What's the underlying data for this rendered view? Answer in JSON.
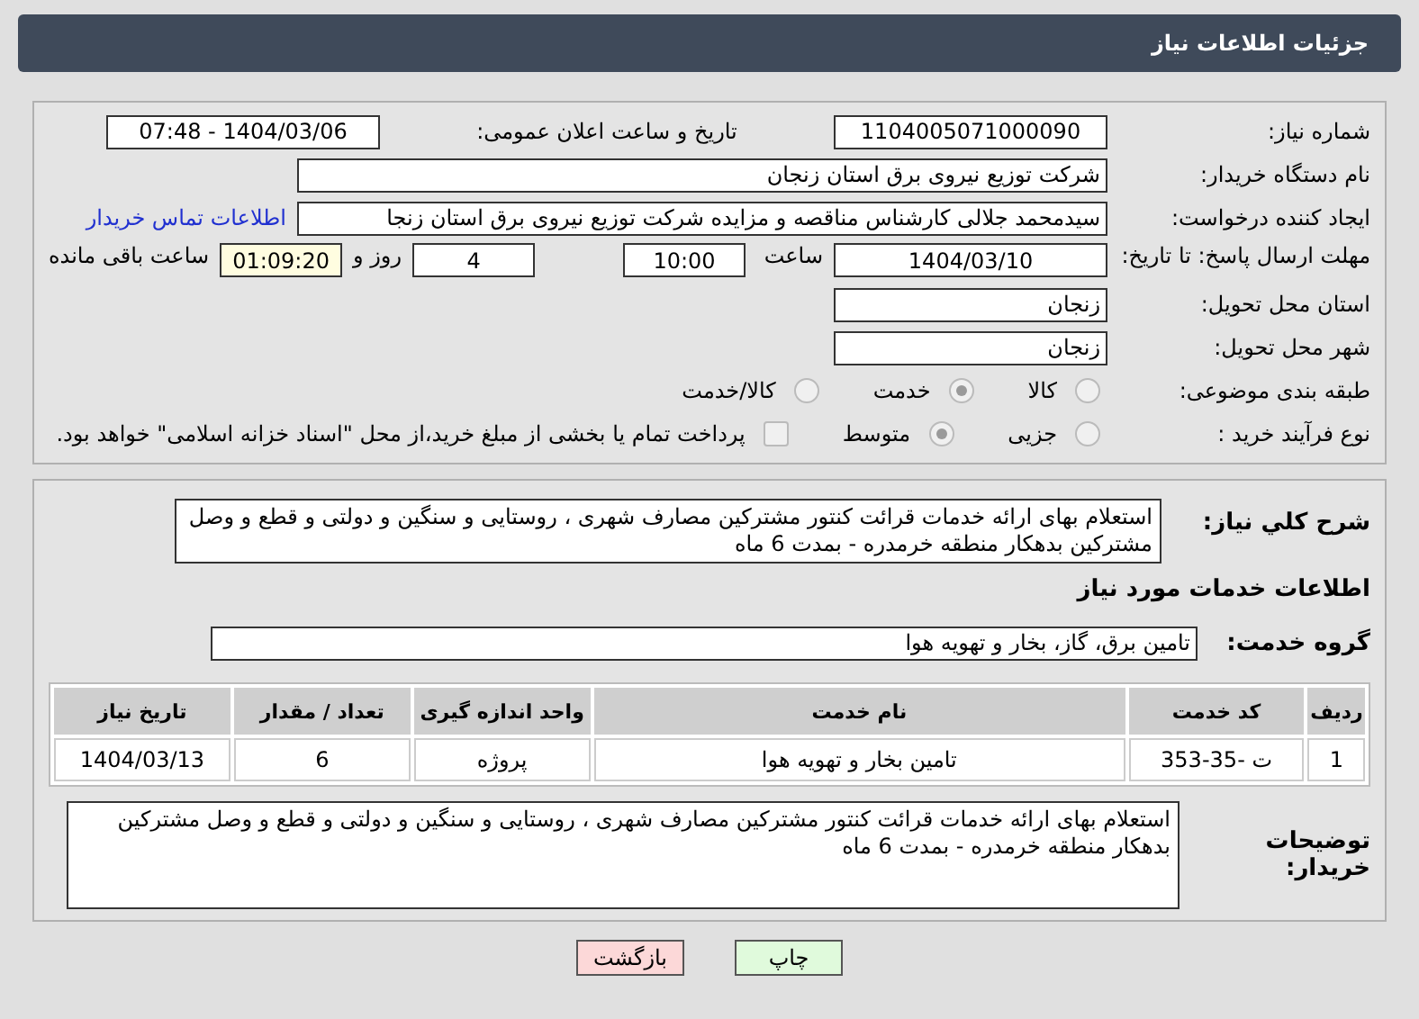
{
  "header": {
    "title": "جزئیات اطلاعات نیاز"
  },
  "need_number": {
    "label": "شماره نیاز:",
    "value": "1104005071000090"
  },
  "announce": {
    "label": "تاریخ و ساعت اعلان عمومی:",
    "value": "1404/03/06 - 07:48"
  },
  "buyer": {
    "label": "نام دستگاه خریدار:",
    "value": "شرکت توزیع نیروی برق استان زنجان"
  },
  "creator": {
    "label": "ایجاد کننده درخواست:",
    "value": "سیدمحمد جلالی کارشناس مناقصه و مزایده شرکت توزیع نیروی برق استان زنجا",
    "link": "اطلاعات تماس خریدار"
  },
  "deadline": {
    "label": "مهلت ارسال پاسخ: تا تاریخ:",
    "date": "1404/03/10",
    "time_label": "ساعت",
    "time": "10:00",
    "days": "4",
    "days_label": "روز و",
    "remaining": "01:09:20",
    "remaining_label": "ساعت باقی مانده"
  },
  "province": {
    "label": "استان محل تحویل:",
    "value": "زنجان"
  },
  "city": {
    "label": "شهر محل تحویل:",
    "value": "زنجان"
  },
  "category": {
    "label": "طبقه بندی موضوعی:",
    "options": [
      {
        "label": "کالا",
        "selected": false
      },
      {
        "label": "خدمت",
        "selected": true
      },
      {
        "label": "کالا/خدمت",
        "selected": false
      }
    ]
  },
  "process": {
    "label": "نوع فرآیند خرید :",
    "options": [
      {
        "label": "جزیی",
        "selected": false
      },
      {
        "label": "متوسط",
        "selected": true
      }
    ],
    "payment": {
      "checked": false,
      "label": "پرداخت تمام یا بخشی از مبلغ خرید،از محل \"اسناد خزانه اسلامی\" خواهد بود."
    }
  },
  "description": {
    "label": "شرح کلي نياز:",
    "value": "استعلام بهای ارائه خدمات قرائت کنتور مشترکین مصارف شهری ، روستایی و سنگین و دولتی و قطع و وصل مشترکین بدهکار منطقه خرمدره - بمدت 6 ماه"
  },
  "services_title": "اطلاعات خدمات مورد نیاز",
  "service_group": {
    "label": "گروه خدمت:",
    "value": "تامین برق، گاز، بخار و تهویه هوا"
  },
  "table": {
    "columns": [
      "ردیف",
      "کد خدمت",
      "نام خدمت",
      "واحد اندازه گیری",
      "تعداد / مقدار",
      "تاریخ نیاز"
    ],
    "rows": [
      [
        "1",
        "ت -35-353",
        "تامین بخار و تهویه هوا",
        "پروژه",
        "6",
        "1404/03/13"
      ]
    ]
  },
  "notes": {
    "label": "توضیحات خریدار:",
    "value": "استعلام بهای ارائه خدمات قرائت کنتور مشترکین مصارف شهری ، روستایی و سنگین و دولتی و قطع و وصل مشترکین بدهکار منطقه خرمدره - بمدت 6 ماه"
  },
  "buttons": [
    {
      "label": "چاپ",
      "kind": "print"
    },
    {
      "label": "بازگشت",
      "kind": "back"
    }
  ]
}
